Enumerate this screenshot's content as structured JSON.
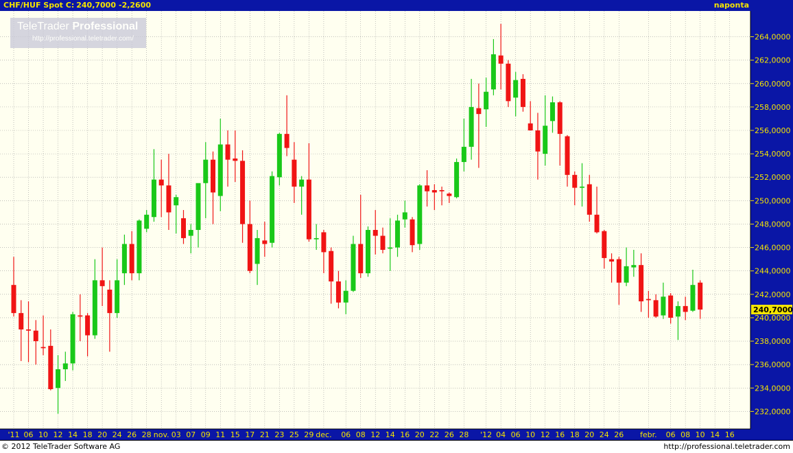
{
  "header": {
    "symbol": "CHF/HUF Spot",
    "close_label": "C:",
    "close_value": "240,7000",
    "change": "-2,2600",
    "period": "naponta"
  },
  "logo": {
    "brand_regular": "TeleTrader",
    "brand_bold": "Professional",
    "url": "http://professional.teletrader.com/"
  },
  "footer": {
    "copyright": "© 2012 TeleTrader Software AG",
    "url": "http://professional.teletrader.com"
  },
  "colors": {
    "up": "#19c819",
    "down": "#f01414",
    "background": "#fffff0",
    "header_bg": "#0a16a6",
    "axis_bg": "#0a16a6",
    "axis_text": "#f4e400",
    "last_price_bg": "#f4e400"
  },
  "chart_data": {
    "type": "candlestick",
    "title": "CHF/HUF Spot",
    "ylim": [
      230.5,
      266.2
    ],
    "grid": true,
    "last_price_label": "240,7000",
    "y_ticks": [
      {
        "value": 232,
        "label": "232,0000"
      },
      {
        "value": 234,
        "label": "234,0000"
      },
      {
        "value": 236,
        "label": "236,0000"
      },
      {
        "value": 238,
        "label": "238,0000"
      },
      {
        "value": 240,
        "label": "240,0000"
      },
      {
        "value": 242,
        "label": "242,0000"
      },
      {
        "value": 244,
        "label": "244,0000"
      },
      {
        "value": 246,
        "label": "246,0000"
      },
      {
        "value": 248,
        "label": "248,0000"
      },
      {
        "value": 250,
        "label": "250,0000"
      },
      {
        "value": 252,
        "label": "252,0000"
      },
      {
        "value": 254,
        "label": "254,0000"
      },
      {
        "value": 256,
        "label": "256,0000"
      },
      {
        "value": 258,
        "label": "258,0000"
      },
      {
        "value": 260,
        "label": "260,0000"
      },
      {
        "value": 262,
        "label": "262,0000"
      },
      {
        "value": 264,
        "label": "264,0000"
      }
    ],
    "x_ticks": [
      {
        "slot": 0,
        "label": "'11"
      },
      {
        "slot": 2,
        "label": "06"
      },
      {
        "slot": 4,
        "label": "10"
      },
      {
        "slot": 6,
        "label": "12"
      },
      {
        "slot": 8,
        "label": "14"
      },
      {
        "slot": 10,
        "label": "18"
      },
      {
        "slot": 12,
        "label": "20"
      },
      {
        "slot": 14,
        "label": "24"
      },
      {
        "slot": 16,
        "label": "26"
      },
      {
        "slot": 18,
        "label": "28"
      },
      {
        "slot": 20,
        "label": "nov."
      },
      {
        "slot": 22,
        "label": "03"
      },
      {
        "slot": 24,
        "label": "07"
      },
      {
        "slot": 26,
        "label": "09"
      },
      {
        "slot": 28,
        "label": "11"
      },
      {
        "slot": 30,
        "label": "15"
      },
      {
        "slot": 32,
        "label": "17"
      },
      {
        "slot": 34,
        "label": "21"
      },
      {
        "slot": 36,
        "label": "23"
      },
      {
        "slot": 38,
        "label": "25"
      },
      {
        "slot": 40,
        "label": "29"
      },
      {
        "slot": 42,
        "label": "dec."
      },
      {
        "slot": 45,
        "label": "06"
      },
      {
        "slot": 47,
        "label": "08"
      },
      {
        "slot": 49,
        "label": "12"
      },
      {
        "slot": 51,
        "label": "14"
      },
      {
        "slot": 53,
        "label": "16"
      },
      {
        "slot": 55,
        "label": "20"
      },
      {
        "slot": 57,
        "label": "22"
      },
      {
        "slot": 59,
        "label": "26"
      },
      {
        "slot": 61,
        "label": "28"
      },
      {
        "slot": 64,
        "label": "'12"
      },
      {
        "slot": 66,
        "label": "04"
      },
      {
        "slot": 68,
        "label": "06"
      },
      {
        "slot": 70,
        "label": "10"
      },
      {
        "slot": 72,
        "label": "12"
      },
      {
        "slot": 74,
        "label": "16"
      },
      {
        "slot": 76,
        "label": "18"
      },
      {
        "slot": 78,
        "label": "20"
      },
      {
        "slot": 80,
        "label": "24"
      },
      {
        "slot": 82,
        "label": "26"
      },
      {
        "slot": 86,
        "label": "febr."
      },
      {
        "slot": 89,
        "label": "06"
      },
      {
        "slot": 91,
        "label": "08"
      },
      {
        "slot": 93,
        "label": "10"
      },
      {
        "slot": 95,
        "label": "14"
      },
      {
        "slot": 97,
        "label": "16"
      }
    ],
    "candles": [
      {
        "o": 242.8,
        "h": 245.2,
        "l": 240.1,
        "c": 240.4
      },
      {
        "o": 240.4,
        "h": 241.5,
        "l": 236.3,
        "c": 239.0
      },
      {
        "o": 239.0,
        "h": 241.4,
        "l": 236.2,
        "c": 238.9
      },
      {
        "o": 238.9,
        "h": 239.8,
        "l": 236.0,
        "c": 238.0
      },
      {
        "o": 237.5,
        "h": 240.2,
        "l": 236.8,
        "c": 237.4
      },
      {
        "o": 237.6,
        "h": 239.0,
        "l": 233.8,
        "c": 233.9
      },
      {
        "o": 234.0,
        "h": 236.8,
        "l": 231.8,
        "c": 235.6
      },
      {
        "o": 235.6,
        "h": 237.1,
        "l": 234.6,
        "c": 236.1
      },
      {
        "o": 236.1,
        "h": 240.5,
        "l": 235.5,
        "c": 240.3
      },
      {
        "o": 240.2,
        "h": 242.0,
        "l": 238.0,
        "c": 240.1
      },
      {
        "o": 240.2,
        "h": 240.4,
        "l": 236.7,
        "c": 238.5
      },
      {
        "o": 238.5,
        "h": 245.0,
        "l": 238.2,
        "c": 243.2
      },
      {
        "o": 243.2,
        "h": 246.0,
        "l": 241.0,
        "c": 242.7
      },
      {
        "o": 242.4,
        "h": 243.2,
        "l": 237.1,
        "c": 240.4
      },
      {
        "o": 240.4,
        "h": 245.0,
        "l": 240.0,
        "c": 243.2
      },
      {
        "o": 243.8,
        "h": 247.1,
        "l": 242.8,
        "c": 246.3
      },
      {
        "o": 246.3,
        "h": 247.4,
        "l": 243.2,
        "c": 243.8
      },
      {
        "o": 243.8,
        "h": 248.4,
        "l": 243.2,
        "c": 248.3
      },
      {
        "o": 247.6,
        "h": 249.2,
        "l": 247.3,
        "c": 248.8
      },
      {
        "o": 248.6,
        "h": 254.4,
        "l": 248.2,
        "c": 251.8
      },
      {
        "o": 251.8,
        "h": 253.5,
        "l": 248.6,
        "c": 251.3
      },
      {
        "o": 251.3,
        "h": 254.0,
        "l": 247.5,
        "c": 249.0
      },
      {
        "o": 249.6,
        "h": 250.5,
        "l": 247.2,
        "c": 250.3
      },
      {
        "o": 248.5,
        "h": 249.2,
        "l": 246.3,
        "c": 246.8
      },
      {
        "o": 247.0,
        "h": 248.0,
        "l": 245.5,
        "c": 247.5
      },
      {
        "o": 247.5,
        "h": 251.2,
        "l": 246.0,
        "c": 251.5
      },
      {
        "o": 251.5,
        "h": 255.0,
        "l": 248.5,
        "c": 253.5
      },
      {
        "o": 253.5,
        "h": 254.2,
        "l": 248.0,
        "c": 250.7
      },
      {
        "o": 250.4,
        "h": 257.0,
        "l": 249.1,
        "c": 254.8
      },
      {
        "o": 254.8,
        "h": 256.0,
        "l": 251.2,
        "c": 253.5
      },
      {
        "o": 253.6,
        "h": 256.0,
        "l": 251.6,
        "c": 253.4
      },
      {
        "o": 253.4,
        "h": 254.3,
        "l": 246.4,
        "c": 248.0
      },
      {
        "o": 248.0,
        "h": 250.0,
        "l": 243.8,
        "c": 244.0
      },
      {
        "o": 244.6,
        "h": 247.5,
        "l": 242.8,
        "c": 246.8
      },
      {
        "o": 246.6,
        "h": 248.2,
        "l": 245.2,
        "c": 246.3
      },
      {
        "o": 246.4,
        "h": 252.5,
        "l": 246.0,
        "c": 252.1
      },
      {
        "o": 252.0,
        "h": 255.8,
        "l": 251.3,
        "c": 255.7
      },
      {
        "o": 255.7,
        "h": 259.0,
        "l": 253.8,
        "c": 254.5
      },
      {
        "o": 253.5,
        "h": 255.0,
        "l": 249.8,
        "c": 251.2
      },
      {
        "o": 251.2,
        "h": 252.1,
        "l": 248.8,
        "c": 251.8
      },
      {
        "o": 251.8,
        "h": 254.9,
        "l": 246.5,
        "c": 246.7
      },
      {
        "o": 246.7,
        "h": 248.0,
        "l": 245.8,
        "c": 246.8
      },
      {
        "o": 247.3,
        "h": 247.5,
        "l": 243.8,
        "c": 245.6
      },
      {
        "o": 245.7,
        "h": 246.0,
        "l": 241.2,
        "c": 243.1
      },
      {
        "o": 243.1,
        "h": 244.0,
        "l": 240.8,
        "c": 241.3
      },
      {
        "o": 241.3,
        "h": 243.2,
        "l": 240.3,
        "c": 242.3
      },
      {
        "o": 242.3,
        "h": 247.0,
        "l": 242.2,
        "c": 246.3
      },
      {
        "o": 246.3,
        "h": 250.5,
        "l": 243.4,
        "c": 243.8
      },
      {
        "o": 243.8,
        "h": 247.8,
        "l": 243.5,
        "c": 247.5
      },
      {
        "o": 247.5,
        "h": 249.2,
        "l": 245.4,
        "c": 247.0
      },
      {
        "o": 247.0,
        "h": 247.7,
        "l": 245.5,
        "c": 245.8
      },
      {
        "o": 245.9,
        "h": 248.5,
        "l": 244.0,
        "c": 246.0
      },
      {
        "o": 246.0,
        "h": 248.8,
        "l": 245.2,
        "c": 248.3
      },
      {
        "o": 248.4,
        "h": 250.0,
        "l": 247.7,
        "c": 249.0
      },
      {
        "o": 248.4,
        "h": 248.6,
        "l": 245.6,
        "c": 246.2
      },
      {
        "o": 246.3,
        "h": 251.4,
        "l": 245.8,
        "c": 251.3
      },
      {
        "o": 251.3,
        "h": 252.6,
        "l": 249.5,
        "c": 250.8
      },
      {
        "o": 250.9,
        "h": 251.4,
        "l": 249.2,
        "c": 250.7
      },
      {
        "o": 250.9,
        "h": 251.2,
        "l": 249.6,
        "c": 250.8
      },
      {
        "o": 250.6,
        "h": 250.7,
        "l": 249.8,
        "c": 250.4
      },
      {
        "o": 250.3,
        "h": 253.6,
        "l": 250.2,
        "c": 253.3
      },
      {
        "o": 253.3,
        "h": 257.0,
        "l": 252.5,
        "c": 254.6
      },
      {
        "o": 254.6,
        "h": 260.4,
        "l": 253.5,
        "c": 258.0
      },
      {
        "o": 257.9,
        "h": 260.0,
        "l": 252.8,
        "c": 257.4
      },
      {
        "o": 257.8,
        "h": 260.5,
        "l": 256.3,
        "c": 259.3
      },
      {
        "o": 259.5,
        "h": 263.8,
        "l": 259.0,
        "c": 262.5
      },
      {
        "o": 262.4,
        "h": 265.1,
        "l": 259.5,
        "c": 261.7
      },
      {
        "o": 261.7,
        "h": 262.0,
        "l": 258.0,
        "c": 258.5
      },
      {
        "o": 258.8,
        "h": 261.0,
        "l": 257.2,
        "c": 260.3
      },
      {
        "o": 260.4,
        "h": 260.8,
        "l": 257.6,
        "c": 258.0
      },
      {
        "o": 256.6,
        "h": 258.5,
        "l": 256.0,
        "c": 256.0
      },
      {
        "o": 256.0,
        "h": 257.5,
        "l": 251.8,
        "c": 254.2
      },
      {
        "o": 254.0,
        "h": 259.0,
        "l": 253.0,
        "c": 256.4
      },
      {
        "o": 256.8,
        "h": 258.9,
        "l": 255.8,
        "c": 258.4
      },
      {
        "o": 258.4,
        "h": 258.5,
        "l": 253.0,
        "c": 255.7
      },
      {
        "o": 255.5,
        "h": 255.6,
        "l": 251.2,
        "c": 252.2
      },
      {
        "o": 252.2,
        "h": 252.5,
        "l": 249.6,
        "c": 251.1
      },
      {
        "o": 251.1,
        "h": 253.2,
        "l": 249.5,
        "c": 251.2
      },
      {
        "o": 251.4,
        "h": 252.2,
        "l": 248.2,
        "c": 248.8
      },
      {
        "o": 248.8,
        "h": 251.2,
        "l": 247.2,
        "c": 247.3
      },
      {
        "o": 247.4,
        "h": 247.5,
        "l": 244.2,
        "c": 245.1
      },
      {
        "o": 245.0,
        "h": 245.5,
        "l": 243.0,
        "c": 244.8
      },
      {
        "o": 245.0,
        "h": 245.2,
        "l": 241.1,
        "c": 243.0
      },
      {
        "o": 243.0,
        "h": 246.0,
        "l": 242.7,
        "c": 244.4
      },
      {
        "o": 244.3,
        "h": 245.8,
        "l": 243.5,
        "c": 244.5
      },
      {
        "o": 244.5,
        "h": 245.5,
        "l": 240.5,
        "c": 241.4
      },
      {
        "o": 241.6,
        "h": 242.3,
        "l": 240.0,
        "c": 241.5
      },
      {
        "o": 241.5,
        "h": 242.0,
        "l": 240.0,
        "c": 240.1
      },
      {
        "o": 240.2,
        "h": 243.0,
        "l": 239.9,
        "c": 241.8
      },
      {
        "o": 241.9,
        "h": 242.1,
        "l": 239.5,
        "c": 240.0
      },
      {
        "o": 240.1,
        "h": 241.4,
        "l": 238.1,
        "c": 241.0
      },
      {
        "o": 241.0,
        "h": 241.8,
        "l": 239.8,
        "c": 240.5
      },
      {
        "o": 240.6,
        "h": 244.1,
        "l": 240.5,
        "c": 242.8
      },
      {
        "o": 243.0,
        "h": 243.2,
        "l": 239.9,
        "c": 240.7
      }
    ]
  }
}
